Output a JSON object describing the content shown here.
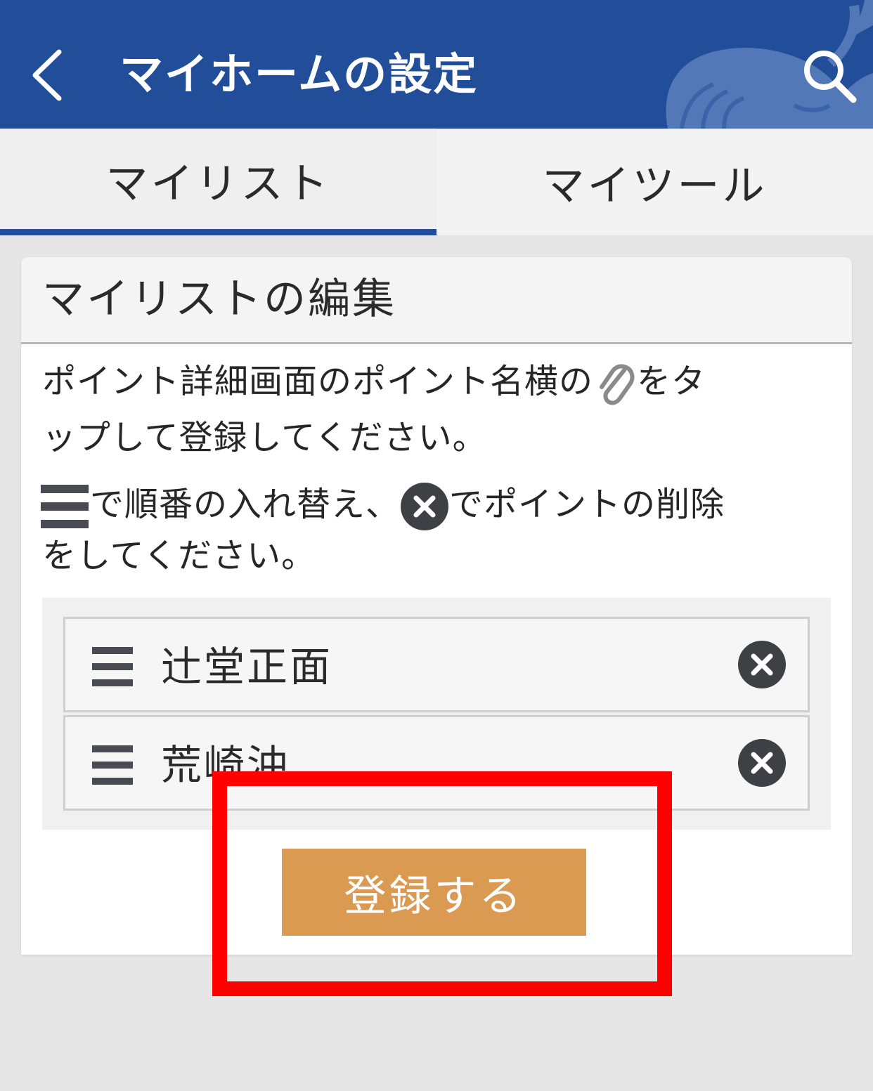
{
  "header": {
    "title": "マイホームの設定",
    "background_color": "#214d99",
    "back_icon": "chevron-left-icon",
    "search_icon": "search-icon"
  },
  "tabs": [
    {
      "label": "マイリスト",
      "active": true
    },
    {
      "label": "マイツール",
      "active": false
    }
  ],
  "card": {
    "title": "マイリストの編集",
    "instructions": {
      "line1_pre": "ポイント詳細画面のポイント名横の",
      "line1_icon": "paperclip-icon",
      "line1_post": "をタ",
      "line2": "ップして登録してください。",
      "line3_icon_a": "drag-handle-icon",
      "line3_mid": "で順番の入れ替え、",
      "line3_icon_b": "delete-circle-icon",
      "line3_post": "でポイントの削除",
      "line4": "をしてください。"
    },
    "list_items": [
      {
        "name": "辻堂正面"
      },
      {
        "name": "荒崎沖"
      }
    ],
    "register_label": "登録する",
    "register_color": "#db9a52"
  },
  "highlight_color": "#ff0000"
}
